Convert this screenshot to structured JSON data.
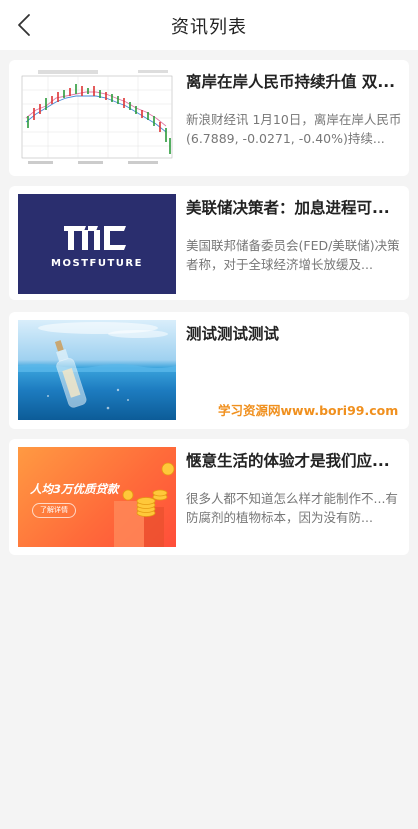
{
  "header": {
    "title": "资讯列表",
    "back_icon": "chevron-left-icon"
  },
  "articles": [
    {
      "title": "离岸在岸人民币持续升值 双...",
      "desc": "新浪财经讯 1月10日，离岸在岸人民币(6.7889, -0.0271, -0.40%)持续..."
    },
    {
      "title": "美联储决策者：加息进程可...",
      "desc": "美国联邦储备委员会(FED/美联储)决策者称，对于全球经济增长放缓及...",
      "thumb_text": "MOSTFUTURE"
    },
    {
      "title": "测试测试测试",
      "desc": ""
    },
    {
      "title": "惬意生活的体验才是我们应...",
      "desc": "很多人都不知道怎么样才能制作不...有防腐剂的植物标本，因为没有防...",
      "thumb_text": "人均3万优质贷款",
      "thumb_button": "了解详情"
    }
  ],
  "watermark": "学习资源网www.bori99.com",
  "colors": {
    "background": "#f4f4f4",
    "card": "#ffffff",
    "watermark": "#f0901e",
    "logo_bg": "#2a2e6e"
  }
}
